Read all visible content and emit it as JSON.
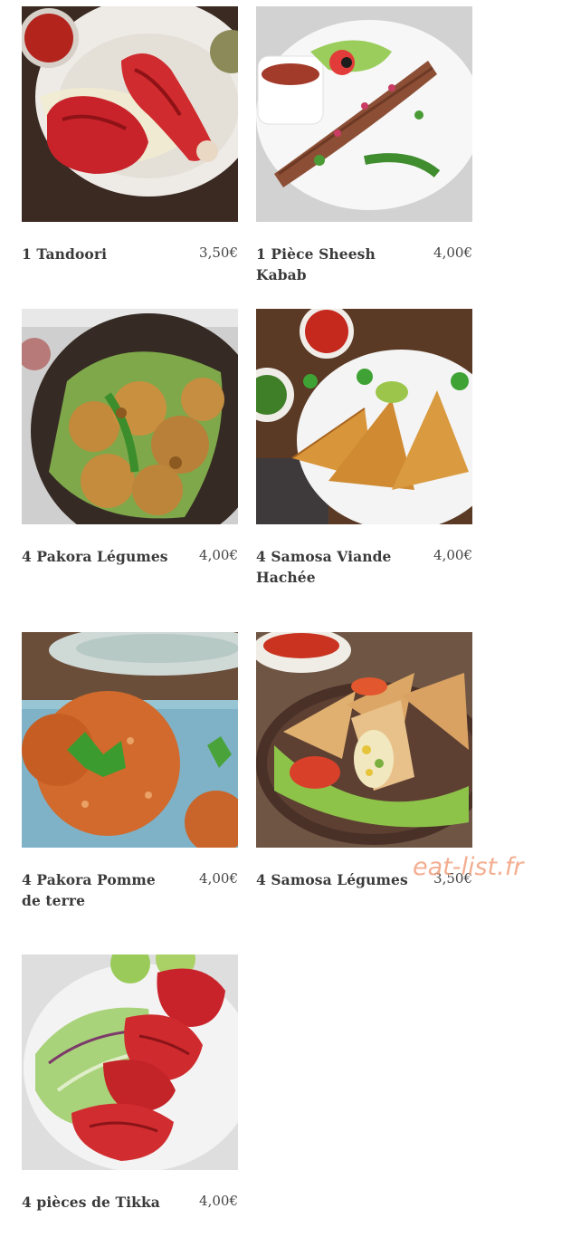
{
  "menu": {
    "items": [
      {
        "name": "1 Tandoori",
        "price": "3,50€",
        "image_icon": "tandoori-chicken-icon"
      },
      {
        "name": "1 Pièce Sheesh Kabab",
        "price": "4,00€",
        "image_icon": "sheesh-kabab-icon"
      },
      {
        "name": "4 Pakora Légumes",
        "price": "4,00€",
        "image_icon": "vegetable-pakora-icon"
      },
      {
        "name": "4 Samosa Viande Hachée",
        "price": "4,00€",
        "image_icon": "meat-samosa-icon"
      },
      {
        "name": "4 Pakora Pomme de terre",
        "price": "4,00€",
        "image_icon": "potato-pakora-icon"
      },
      {
        "name": "4 Samosa Légumes",
        "price": "3,50€",
        "image_icon": "vegetable-samosa-icon"
      },
      {
        "name": "4 pièces de Tikka",
        "price": "4,00€",
        "image_icon": "chicken-tikka-icon"
      }
    ]
  },
  "watermark": "eat-list.fr",
  "colors": {
    "tandoori_red": "#c8232a",
    "pastry_gold": "#d9953a",
    "pakora_orange": "#c8702c",
    "lettuce_green": "#8ec34a"
  }
}
